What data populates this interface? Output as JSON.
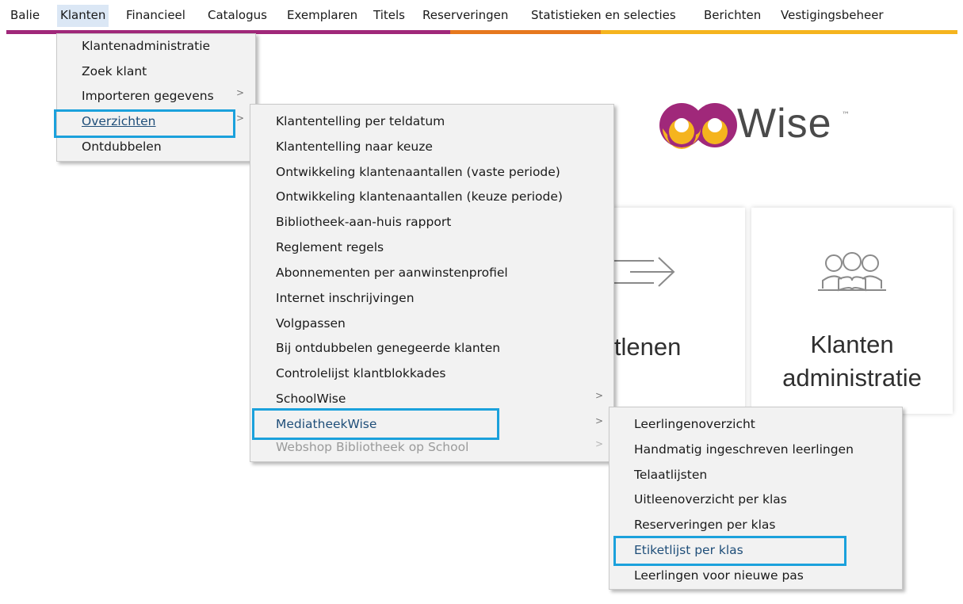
{
  "menubar": {
    "items": [
      "Balie",
      "Klanten",
      "Financieel",
      "Catalogus",
      "Exemplaren",
      "Titels",
      "Reserveringen",
      "Statistieken en selecties",
      "Berichten",
      "Vestigingsbeheer"
    ],
    "active_item": "Klanten"
  },
  "strip_colors": [
    "#a0287a",
    "#e6781e",
    "#f5b41e"
  ],
  "klanten_menu": {
    "items": [
      {
        "label": "Klantenadministratie",
        "submenu": false
      },
      {
        "label": "Zoek klant",
        "submenu": false
      },
      {
        "label": "Importeren gegevens",
        "submenu": true
      },
      {
        "label": "Overzichten",
        "submenu": true,
        "highlighted": true
      },
      {
        "label": "Ontdubbelen",
        "submenu": false
      }
    ]
  },
  "overzichten_menu": {
    "items": [
      {
        "label": "Klantentelling per teldatum"
      },
      {
        "label": "Klantentelling naar keuze"
      },
      {
        "label": "Ontwikkeling klantenaantallen (vaste periode)"
      },
      {
        "label": "Ontwikkeling klantenaantallen (keuze periode)"
      },
      {
        "label": "Bibliotheek-aan-huis rapport"
      },
      {
        "label": "Reglement regels"
      },
      {
        "label": "Abonnementen per aanwinstenprofiel"
      },
      {
        "label": "Internet inschrijvingen"
      },
      {
        "label": "Volgpassen"
      },
      {
        "label": "Bij ontdubbelen genegeerde klanten"
      },
      {
        "label": "Controlelijst klantblokkades"
      },
      {
        "label": "SchoolWise",
        "submenu": true
      },
      {
        "label": "MediatheekWise",
        "submenu": true,
        "highlighted": true
      },
      {
        "label": "Webshop Bibliotheek op School",
        "submenu": true,
        "disabled": true
      }
    ]
  },
  "mediatheek_menu": {
    "items": [
      {
        "label": "Leerlingenoverzicht"
      },
      {
        "label": "Handmatig ingeschreven leerlingen"
      },
      {
        "label": "Telaatlijsten"
      },
      {
        "label": "Uitleenoverzicht per klas"
      },
      {
        "label": "Reserveringen per klas"
      },
      {
        "label": "Etiketlijst per klas",
        "highlighted": true
      },
      {
        "label": "Leerlingen voor nieuwe pas"
      }
    ]
  },
  "logo": {
    "text": "Wise",
    "tm": "™",
    "colors": [
      "#a0287a",
      "#f5b41e"
    ]
  },
  "tiles": {
    "uitlenen": {
      "label": "itlenen",
      "icon": "arrow-right-icon"
    },
    "klanten": {
      "line1": "Klanten",
      "line2": "administratie",
      "icon": "people-reading-icon"
    }
  },
  "submenu_arrow": ">",
  "highlight_color": "#1ba1dc"
}
